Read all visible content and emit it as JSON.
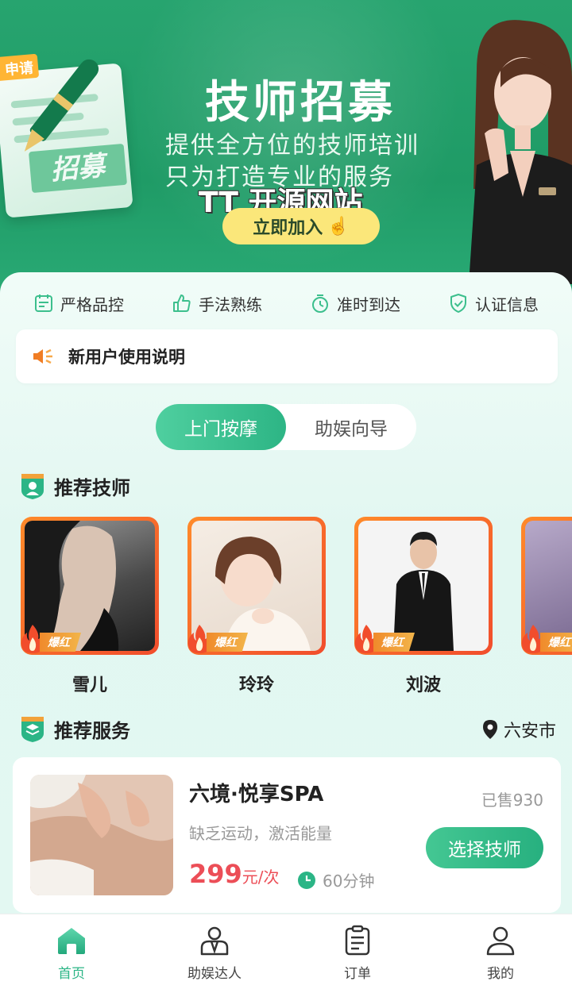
{
  "banner": {
    "tag": "申请",
    "stamp": "招募",
    "title": "技师招募",
    "subtitle_1": "提供全方位的技师培训",
    "subtitle_2": "只为打造专业的服务",
    "watermark": "TT 开源网站",
    "join_button": "立即加入"
  },
  "features": [
    {
      "icon": "quality-control-icon",
      "label": "严格品控"
    },
    {
      "icon": "thumbs-up-icon",
      "label": "手法熟练"
    },
    {
      "icon": "stopwatch-icon",
      "label": "准时到达"
    },
    {
      "icon": "verified-shield-icon",
      "label": "认证信息"
    }
  ],
  "notice": {
    "icon": "megaphone-icon",
    "text": "新用户使用说明"
  },
  "tabs": [
    {
      "label": "上门按摩",
      "active": true
    },
    {
      "label": "助娱向导",
      "active": false
    }
  ],
  "recommended_techs": {
    "title": "推荐技师",
    "badge": "爆红",
    "items": [
      {
        "name": "雪儿"
      },
      {
        "name": "玲玲"
      },
      {
        "name": "刘波"
      },
      {
        "name": ""
      }
    ]
  },
  "recommended_services": {
    "title": "推荐服务",
    "location": "六安市",
    "items": [
      {
        "name": "六境·悦享SPA",
        "sold": "已售930",
        "desc": "缺乏运动，激活能量",
        "price": "299",
        "unit": "元/次",
        "duration": "60分钟",
        "button": "选择技师"
      }
    ]
  },
  "bottom_nav": [
    {
      "label": "首页",
      "icon": "home-icon",
      "active": true
    },
    {
      "label": "助娱达人",
      "icon": "expert-icon",
      "active": false
    },
    {
      "label": "订单",
      "icon": "clipboard-icon",
      "active": false
    },
    {
      "label": "我的",
      "icon": "user-icon",
      "active": false
    }
  ],
  "colors": {
    "brand_green": "#2bb586",
    "price_red": "#ec4e57",
    "hot_orange": "#f14d2c",
    "join_yellow": "#fbe77a"
  }
}
